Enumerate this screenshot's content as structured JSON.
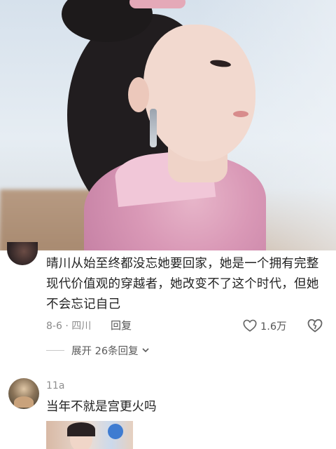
{
  "video": {
    "description_icon": "video-still-frame"
  },
  "comment": {
    "text": "晴川从始至终都没忘她要回家，她是一个拥有完整现代价值观的穿越者，她改变不了这个时代，但她不会忘记自己",
    "date_location": "8-6 · 四川",
    "reply_label": "回复",
    "like_count": "1.6万",
    "expand_label": "展开 26条回复"
  },
  "reply": {
    "username": "11a",
    "text": "当年不就是宫更火吗"
  },
  "icons": {
    "like": "heart-outline-icon",
    "dislike": "dislike-heart-icon",
    "expand": "chevron-down-icon"
  }
}
